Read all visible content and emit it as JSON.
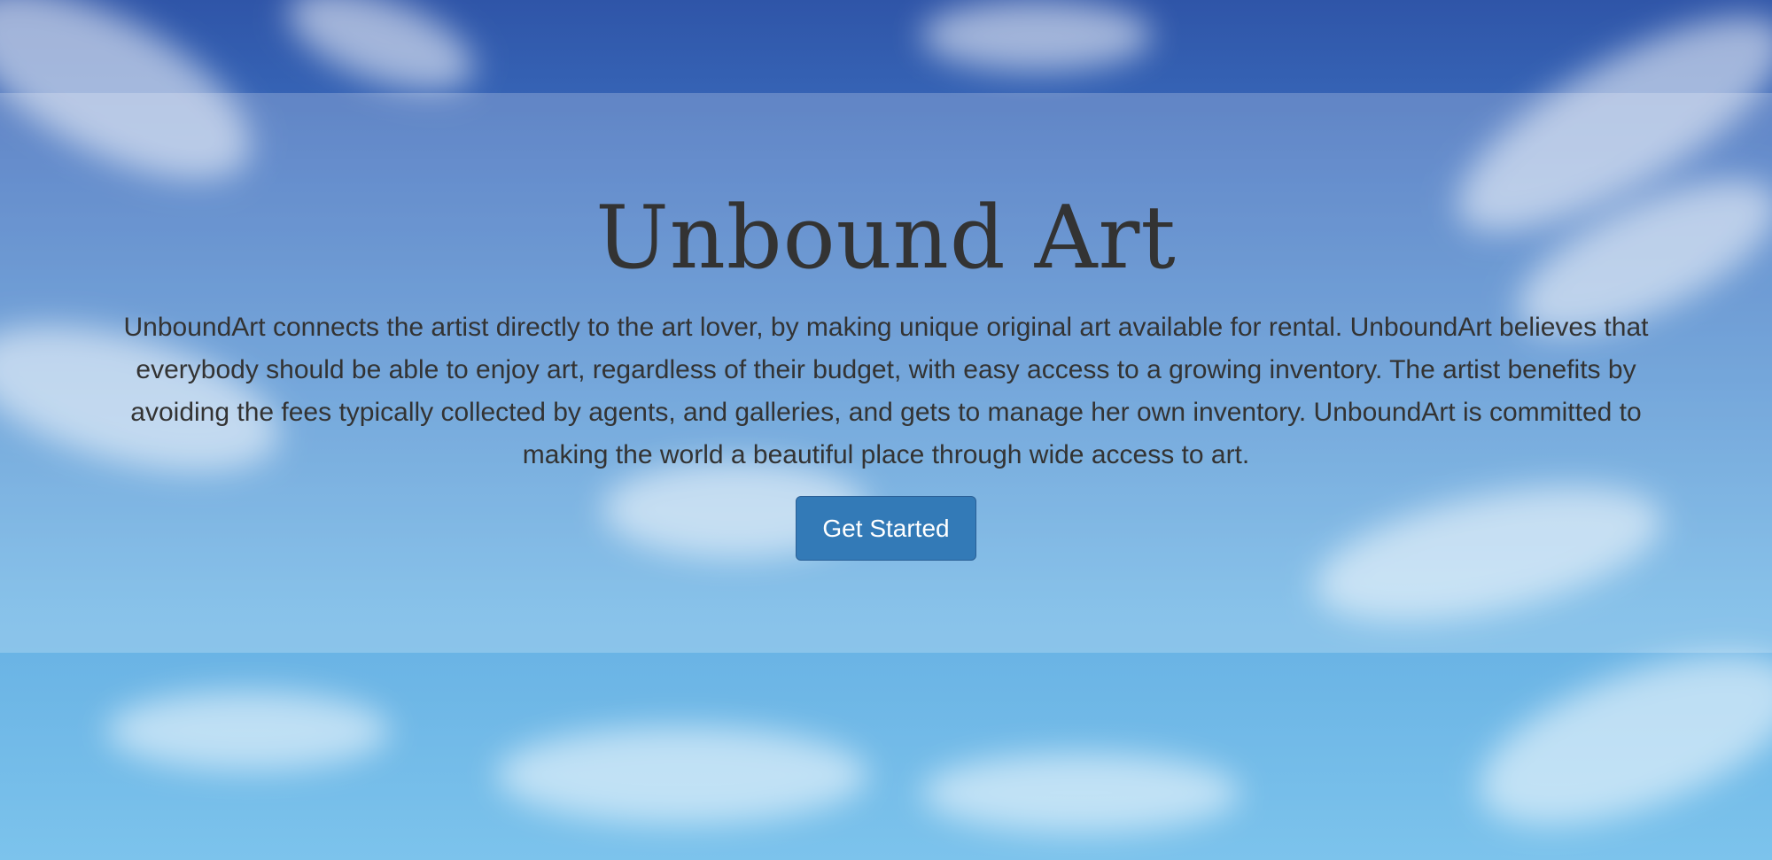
{
  "hero": {
    "title": "Unbound Art",
    "description": "UnboundArt connects the artist directly to the art lover, by making unique original art available for rental. UnboundArt believes that everybody should be able to enjoy art, regardless of their budget, with easy access to a growing inventory. The artist benefits by avoiding the fees typically collected by agents, and galleries, and gets to manage her own inventory. UnboundArt is committed to making the world a beautiful place through wide access to art.",
    "cta_label": "Get Started"
  },
  "colors": {
    "text": "#333333",
    "button_bg": "#337ab7",
    "button_text": "#ffffff",
    "sky_top": "#2f55a8",
    "sky_bottom": "#7cc3ec"
  }
}
